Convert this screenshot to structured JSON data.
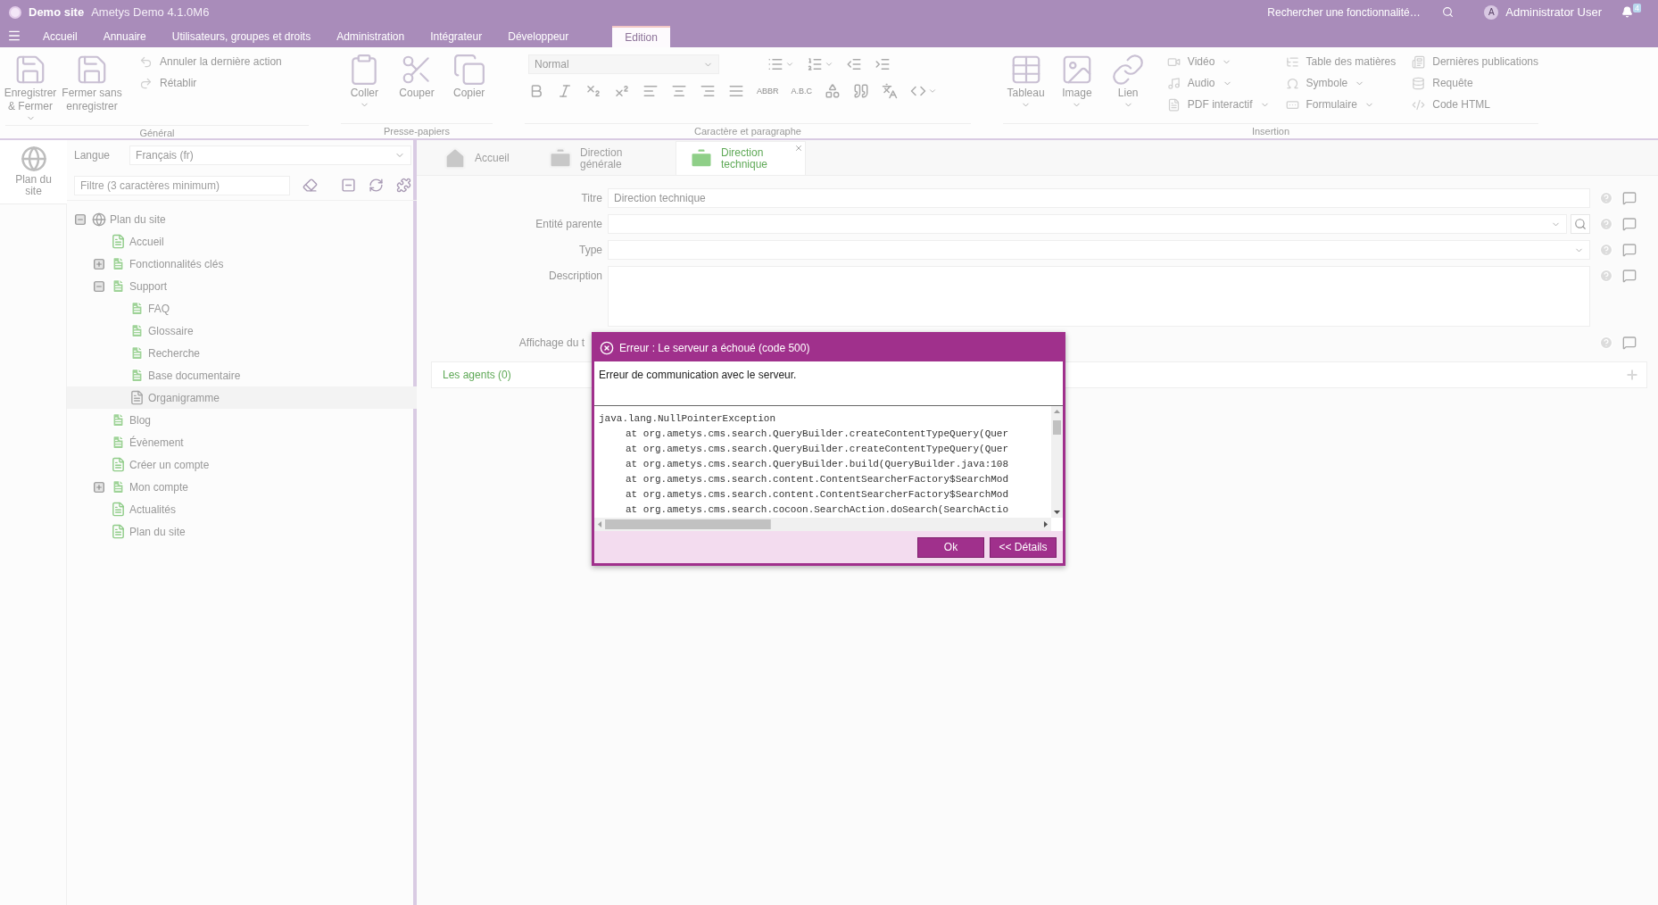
{
  "header": {
    "site": "Demo site",
    "version": "Ametys Demo 4.1.0M6",
    "search_placeholder": "Rechercher une fonctionnalité…",
    "user_initial": "A",
    "user_name": "Administrator User",
    "notifications": "4"
  },
  "menu": [
    {
      "label": "Accueil",
      "selected": false
    },
    {
      "label": "Annuaire",
      "selected": false
    },
    {
      "label": "Utilisateurs, groupes et droits",
      "selected": false
    },
    {
      "label": "Administration",
      "selected": false
    },
    {
      "label": "Intégrateur",
      "selected": false
    },
    {
      "label": "Développeur",
      "selected": false
    },
    {
      "label": "Edition",
      "selected": true
    }
  ],
  "ribbon": [
    {
      "kind": "buttons",
      "label": "Général",
      "big": [
        {
          "lines": [
            "Enregistrer",
            "& Fermer"
          ],
          "menu": true
        },
        {
          "lines": [
            "Fermer sans",
            "enregistrer"
          ],
          "menu": false
        }
      ],
      "small": [
        {
          "label": "Annuler la dernière action",
          "menu": false
        },
        {
          "label": "Rétablir",
          "menu": false
        }
      ]
    },
    {
      "kind": "buttons",
      "label": "Presse-papiers",
      "big": [
        {
          "lines": [
            "Coller"
          ],
          "menu": true
        },
        {
          "lines": [
            "Couper"
          ],
          "menu": false
        },
        {
          "lines": [
            "Copier"
          ],
          "menu": false
        }
      ]
    },
    {
      "kind": "format",
      "label": "Caractère et paragraphe",
      "style": "Normal",
      "text_buttons": [
        "ABBR",
        "A.B.C"
      ]
    },
    {
      "kind": "buttons",
      "label": "Insertion",
      "big": [
        {
          "lines": [
            "Tableau"
          ],
          "menu": true
        },
        {
          "lines": [
            "Image"
          ],
          "menu": true
        },
        {
          "lines": [
            "Lien"
          ],
          "menu": true
        }
      ],
      "small": [
        {
          "label": "Vidéo",
          "menu": true
        },
        {
          "label": "Audio",
          "menu": true
        },
        {
          "label": "PDF interactif",
          "menu": true
        },
        {
          "label": "Table des matières",
          "menu": false
        },
        {
          "label": "Symbole",
          "menu": true
        },
        {
          "label": "Formulaire",
          "menu": true
        },
        {
          "label": "Dernières publications",
          "menu": false
        },
        {
          "label": "Requête",
          "menu": false
        },
        {
          "label": "Code HTML",
          "menu": false
        }
      ]
    }
  ],
  "sidebar": {
    "tab": "Plan du site",
    "language_label": "Langue",
    "language": "Français (fr)",
    "filter_placeholder": "Filtre (3 caractères minimum)",
    "tree": [
      {
        "label": "Plan du site",
        "kind": "globe",
        "expanded": true,
        "selected": false,
        "children": [
          {
            "label": "Accueil",
            "kind": "page-outline",
            "selected": false
          },
          {
            "label": "Fonctionnalités clés",
            "kind": "page-filled",
            "expanded": false,
            "selected": false
          },
          {
            "label": "Support",
            "kind": "page-filled",
            "expanded": true,
            "selected": false,
            "children": [
              {
                "label": "FAQ",
                "kind": "page-filled",
                "selected": false
              },
              {
                "label": "Glossaire",
                "kind": "page-filled",
                "selected": false
              },
              {
                "label": "Recherche",
                "kind": "page-filled",
                "selected": false
              },
              {
                "label": "Base documentaire",
                "kind": "page-filled",
                "selected": false
              },
              {
                "label": "Organigramme",
                "kind": "page-grey",
                "selected": true
              }
            ]
          },
          {
            "label": "Blog",
            "kind": "page-filled",
            "selected": false
          },
          {
            "label": "Évènement",
            "kind": "page-filled",
            "selected": false
          },
          {
            "label": "Créer un compte",
            "kind": "page-outline",
            "selected": false
          },
          {
            "label": "Mon compte",
            "kind": "page-filled",
            "expanded": false,
            "selected": false
          },
          {
            "label": "Actualités",
            "kind": "page-outline",
            "selected": false
          },
          {
            "label": "Plan du site",
            "kind": "page-outline",
            "selected": false
          }
        ]
      }
    ]
  },
  "editor": {
    "tabs": [
      {
        "label": "Accueil",
        "selected": false,
        "closable": false
      },
      {
        "label": "Direction générale",
        "selected": false,
        "closable": false
      },
      {
        "label": "Direction technique",
        "selected": true,
        "closable": true
      }
    ],
    "fields": [
      {
        "label": "Titre",
        "kind": "text",
        "value": "Direction technique"
      },
      {
        "label": "Entité parente",
        "kind": "combo-search"
      },
      {
        "label": "Type",
        "kind": "combo"
      },
      {
        "label": "Description",
        "kind": "textarea"
      },
      {
        "label": "Affichage du t",
        "kind": "covered"
      }
    ],
    "panel": "Les agents (0)"
  },
  "dialog": {
    "title": "Erreur : Le serveur a échoué (code 500)",
    "message": "Erreur de communication avec le serveur.",
    "exception": "java.lang.NullPointerException",
    "frames": [
      "at org.ametys.cms.search.QueryBuilder.createContentTypeQuery(Quer",
      "at org.ametys.cms.search.QueryBuilder.createContentTypeQuery(Quer",
      "at org.ametys.cms.search.QueryBuilder.build(QueryBuilder.java:108",
      "at org.ametys.cms.search.content.ContentSearcherFactory$SearchMod",
      "at org.ametys.cms.search.content.ContentSearcherFactory$SearchMod",
      "at org.ametys.cms.search.cocoon.SearchAction.doSearch(SearchActio"
    ],
    "buttons": [
      "Ok",
      "<< Détails"
    ]
  }
}
